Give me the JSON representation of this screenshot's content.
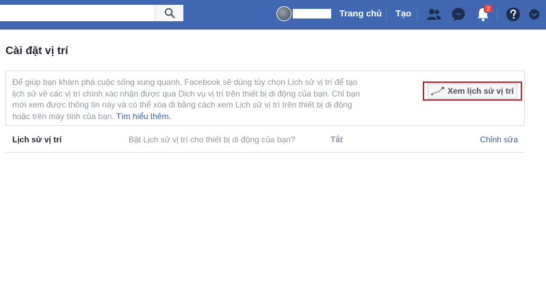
{
  "topbar": {
    "search_placeholder": "",
    "nav_home": "Trang chủ",
    "nav_create": "Tạo",
    "notifications_count": "2",
    "icons": [
      "search-icon",
      "friends-icon",
      "messenger-icon",
      "bell-icon",
      "help-icon",
      "chevron-down-icon"
    ]
  },
  "page": {
    "title": "Cài đặt vị trí",
    "info_text": "Để giúp bạn khám phá cuộc sống xung quanh, Facebook sẽ dùng tùy chọn Lịch sử vị trí để tạo lịch sử về các vị trí chính xác nhận được qua Dịch vụ vị trí trên thiết bị di động của bạn. Chỉ bạn mới xem được thông tin này và có thể xóa đi bằng cách xem Lịch sử vị trí trên thiết bị di động hoặc trên máy tính của bạn.",
    "learn_more": "Tìm hiểu thêm.",
    "history_button": "Xem lịch sử vị trí"
  },
  "setting_row": {
    "label": "Lịch sử vị trí",
    "question": "Bật Lịch sử vị trí cho thiết bị di động của bạn?",
    "value": "Tắt",
    "edit": "Chỉnh sửa"
  },
  "colors": {
    "topbar": "#4267b2",
    "link": "#365899",
    "highlight_border": "#c0202a",
    "badge": "#fa3e3e"
  }
}
